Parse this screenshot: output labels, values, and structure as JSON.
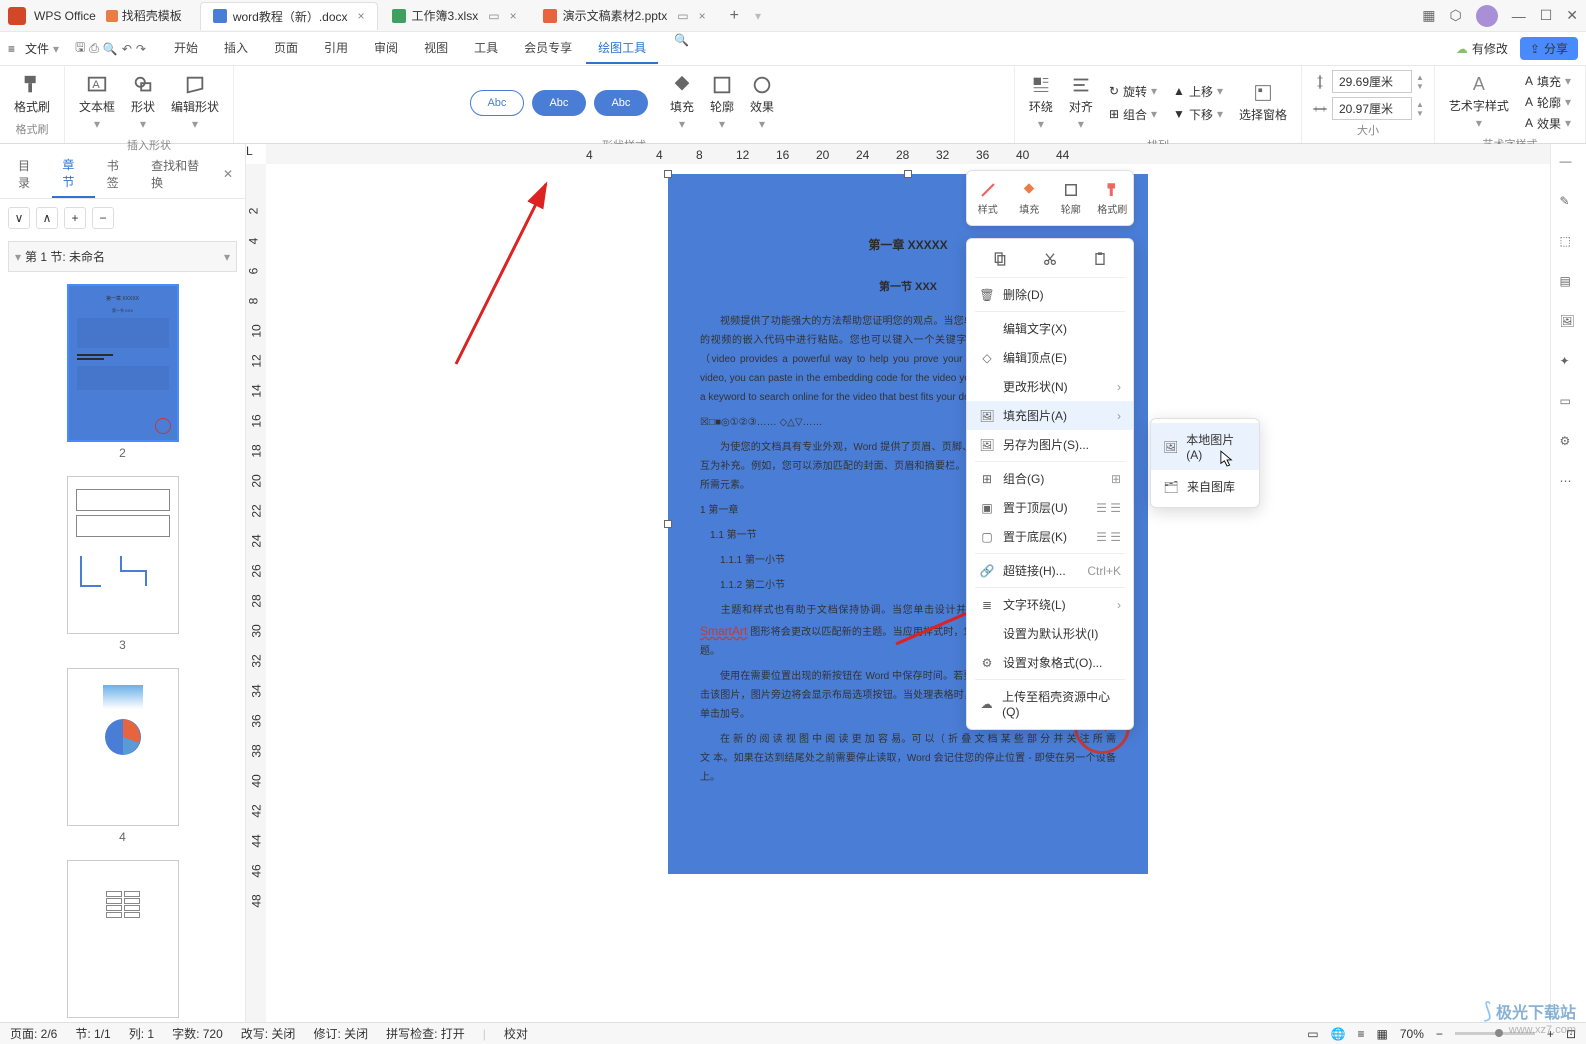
{
  "titlebar": {
    "app_name": "WPS Office",
    "home_tab": "找稻壳模板",
    "doc_tabs": [
      {
        "icon": "w",
        "label": "word教程（新）.docx",
        "active": true,
        "closable": true
      },
      {
        "icon": "s",
        "label": "工作簿3.xlsx",
        "min": true
      },
      {
        "icon": "p",
        "label": "演示文稿素材2.pptx",
        "min": true
      }
    ]
  },
  "menubar": {
    "file": "文件",
    "tabs": [
      "开始",
      "插入",
      "页面",
      "引用",
      "审阅",
      "视图",
      "工具",
      "会员专享",
      "绘图工具"
    ],
    "active_tab": "绘图工具",
    "modify": "有修改",
    "share": "分享"
  },
  "ribbon": {
    "group1": {
      "label": "格式刷",
      "btn": "格式刷"
    },
    "group2": {
      "label": "插入形状",
      "btns": [
        "文本框",
        "形状",
        "编辑形状"
      ]
    },
    "group3": {
      "label": "形状样式",
      "pill": "Abc",
      "right": [
        "填充",
        "轮廓",
        "效果"
      ]
    },
    "group4": {
      "label": "排列",
      "items": [
        "环绕",
        "对齐",
        "旋转",
        "组合",
        "上移",
        "下移",
        "选择窗格"
      ]
    },
    "group5": {
      "label": "大小",
      "width": "29.69厘米",
      "height": "20.97厘米"
    },
    "group6": {
      "label": "艺术字样式",
      "btn": "艺术字样式",
      "right": [
        "填充",
        "轮廓",
        "效果"
      ]
    }
  },
  "nav": {
    "tabs": [
      "目录",
      "章节",
      "书签",
      "查找和替换"
    ],
    "active": "章节",
    "section": "第 1 节: 未命名",
    "thumbs": [
      "2",
      "3",
      "4"
    ]
  },
  "ruler_h": [
    "4",
    "4",
    "8",
    "12",
    "16",
    "20",
    "24",
    "28",
    "32",
    "36",
    "40",
    "44"
  ],
  "ruler_v": [
    "2",
    "4",
    "6",
    "8",
    "10",
    "12",
    "14",
    "16",
    "18",
    "20",
    "22",
    "24",
    "26",
    "28",
    "30",
    "32",
    "34",
    "36",
    "38",
    "40",
    "42",
    "44",
    "46",
    "48"
  ],
  "page": {
    "h1": "第一章 XXXXX",
    "h2": "第一节 XXX",
    "p1": "视频提供了功能强大的方法帮助您证明您的观点。当您单击联机视频时，可以在想要添加的视频的嵌入代码中进行粘贴。您也可以键入一个关键字以联机搜索最适合您的文档的。（video provides a powerful way to help you prove your point. When you click the online video, you can paste in the embedding code for the video you want to add. You can also type a keyword to search online for the video that best fits your document.）",
    "p1b": "☒□■◎①②③…… ◇△▽……",
    "p2": "为使您的文档具有专业外观，Word 提供了页眉、页脚、封面和文本框设计，这些设计可互为补充。例如，您可以添加匹配的封面、页眉和摘要栏。单击\"插入\"，然后从不同库中选择所需元素。",
    "li1": "1   第一章",
    "li2": "1.1   第一节",
    "li3": "1.1.1   第一小节",
    "li4": "1.1.2   第二小节",
    "p3": "主题和样式也有助于文档保持协调。当您单击设计并选择新的主题时，图片、图表或 SmartArt 图形将会更改以匹配新的主题。当应用样式时，您的标题会进行更改以匹配新的主题。",
    "smartart": "SmartArt",
    "p4": "使用在需要位置出现的新按钮在 Word 中保存时间。若要更改图片适应文档的方式，请单击该图片，图片旁边将会显示布局选项按钮。当处理表格时，单击要添加行或列的位置，然后单击加号。",
    "p5": "在 新 的 阅 读 视 图 中 阅 读 更 加 容 易。可 以（ 折 叠 文 档 某 些 部 分 并 关 注 所 需 文 本。如果在达到结尾处之前需要停止读取，Word 会记住您的停止位置 - 即使在另一个设备上。"
  },
  "float_toolbar": [
    "样式",
    "填充",
    "轮廓",
    "格式刷"
  ],
  "context_menu": {
    "delete": "删除(D)",
    "edit_text": "编辑文字(X)",
    "edit_vertex": "编辑顶点(E)",
    "change_shape": "更改形状(N)",
    "fill_image": "填充图片(A)",
    "save_as_image": "另存为图片(S)...",
    "group": "组合(G)",
    "bring_front": "置于顶层(U)",
    "send_back": "置于底层(K)",
    "hyperlink": "超链接(H)...",
    "hyperlink_key": "Ctrl+K",
    "text_wrap": "文字环绕(L)",
    "set_default": "设置为默认形状(I)",
    "format_object": "设置对象格式(O)...",
    "upload": "上传至稻壳资源中心(Q)"
  },
  "submenu": {
    "local_image": "本地图片(A)",
    "from_library": "来自图库"
  },
  "statusbar": {
    "page": "页面: 2/6",
    "section": "节: 1/1",
    "col": "列: 1",
    "words": "字数: 720",
    "track": "改写: 关闭",
    "revisions": "修订: 关闭",
    "spell": "拼写检查: 打开",
    "proof": "校对",
    "zoom": "70%"
  },
  "watermark": "极光下载站\nwww.xz7.com"
}
